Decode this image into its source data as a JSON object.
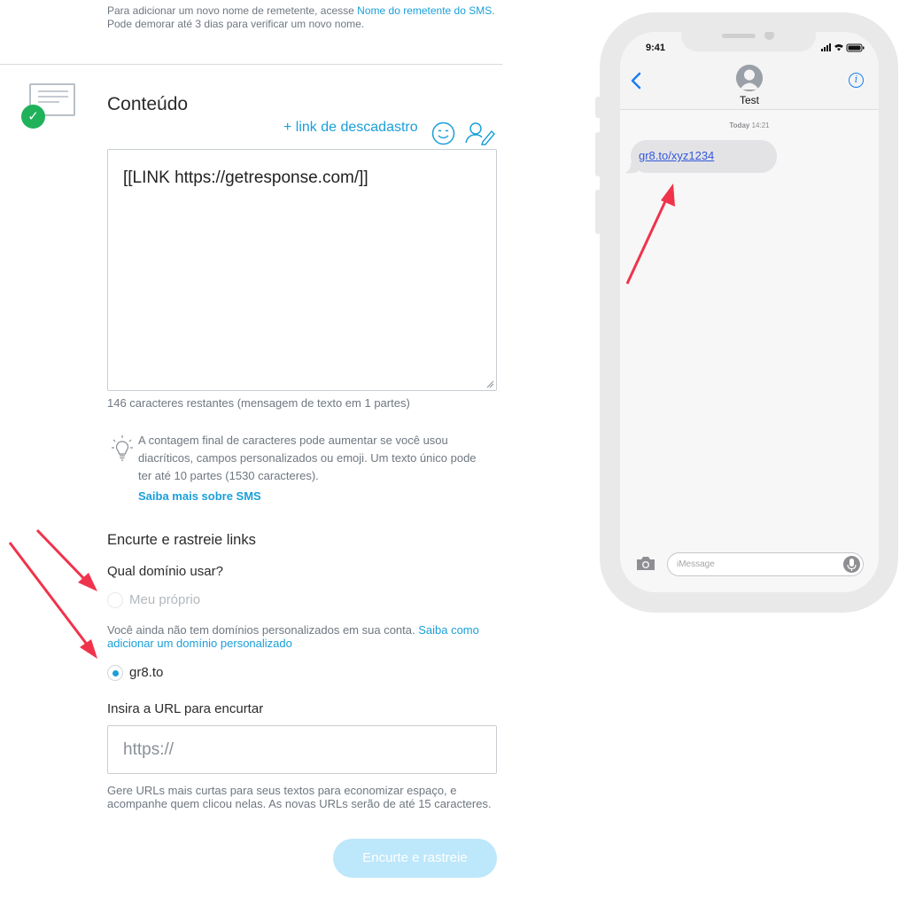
{
  "top_note": {
    "text": "Para adicionar um novo nome de remetente, acesse ",
    "link": "Nome do remetente do SMS",
    "text_after": ". Pode demorar até 3 dias para verificar um novo nome."
  },
  "content_section": {
    "title": "Conteúdo",
    "unsubscribe_link": "+ link de descadastro",
    "message_text": "[[LINK https://getresponse.com/]]",
    "char_count": "146 caracteres restantes (mensagem de texto em 1 partes)",
    "tip_text": "A contagem final de caracteres pode aumentar se você usou diacríticos, campos personalizados ou emoji. Um texto único pode ter até 10 partes (1530 caracteres).",
    "tip_link": "Saiba mais sobre SMS"
  },
  "shorten": {
    "title": "Encurte e rastreie links",
    "domain_question": "Qual domínio usar?",
    "option_own": "Meu próprio",
    "no_domain_text": "Você ainda não tem domínios personalizados em sua conta. ",
    "no_domain_link": "Saiba como adicionar um domínio personalizado",
    "option_gr8": "gr8.to",
    "selected_option": "gr8.to",
    "url_label": "Insira a URL para encurtar",
    "url_placeholder": "https://",
    "url_help": "Gere URLs mais curtas para seus textos para economizar espaço, e acompanhe quem clicou nelas. As novas URLs serão de até 15 caracteres.",
    "button_label": "Encurte e rastreie"
  },
  "phone_preview": {
    "status_time": "9:41",
    "contact_name": "Test",
    "date_label_day": "Today",
    "date_label_time": "14:21",
    "message_link": "gr8.to/xyz1234",
    "input_placeholder": "iMessage"
  },
  "colors": {
    "accent": "#1a9fd9",
    "success": "#1fb25a",
    "button_disabled": "#bde7fb",
    "annotation_arrow": "#f0334b",
    "ios_blue": "#1a7ef0"
  },
  "icons": [
    "card-check-icon",
    "emoji-icon",
    "person-edit-icon",
    "lightbulb-icon",
    "back-chevron-icon",
    "avatar-icon",
    "info-icon",
    "camera-icon",
    "mic-icon"
  ]
}
